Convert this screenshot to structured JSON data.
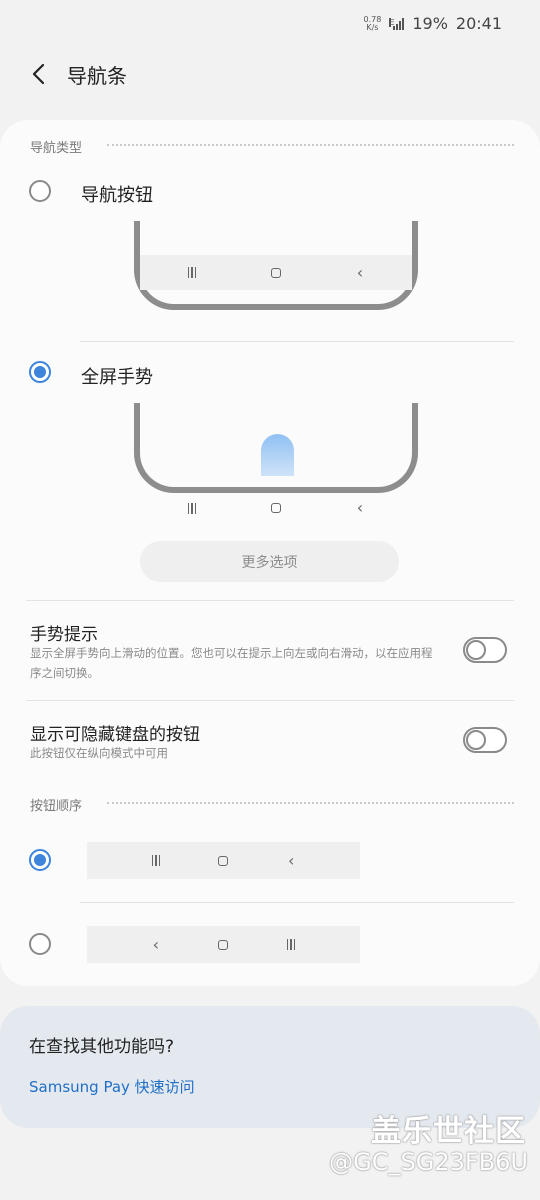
{
  "status_bar": {
    "speed_top": "0.78",
    "speed_bottom": "K/s",
    "network": "E",
    "battery": "19%",
    "time": "20:41"
  },
  "header": {
    "title": "导航条"
  },
  "nav_type": {
    "section_label": "导航类型",
    "buttons_option": {
      "label": "导航按钮",
      "selected": false
    },
    "gesture_option": {
      "label": "全屏手势",
      "selected": true
    },
    "more_options_label": "更多选项"
  },
  "settings": {
    "gesture_hint": {
      "title": "手势提示",
      "description": "显示全屏手势向上滑动的位置。您也可以在提示上向左或向右滑动，以在应用程序之间切换。",
      "enabled": false
    },
    "keyboard_hide": {
      "title": "显示可隐藏键盘的按钮",
      "description": "此按钮仅在纵向模式中可用",
      "enabled": false
    }
  },
  "button_order": {
    "section_label": "按钮顺序",
    "options": [
      {
        "order": [
          "recents-icon",
          "home-icon",
          "back-icon"
        ],
        "selected": true
      },
      {
        "order": [
          "back-icon",
          "home-icon",
          "recents-icon"
        ],
        "selected": false
      }
    ]
  },
  "suggestion": {
    "question": "在查找其他功能吗?",
    "link": "Samsung Pay 快速访问"
  },
  "watermark": {
    "line1": "盖乐世社区",
    "line2": "@GC_SG23FB6U"
  },
  "colors": {
    "accent": "#3d84dc",
    "link": "#1f6ec7",
    "gesture_pill": "#8fc0f3"
  }
}
